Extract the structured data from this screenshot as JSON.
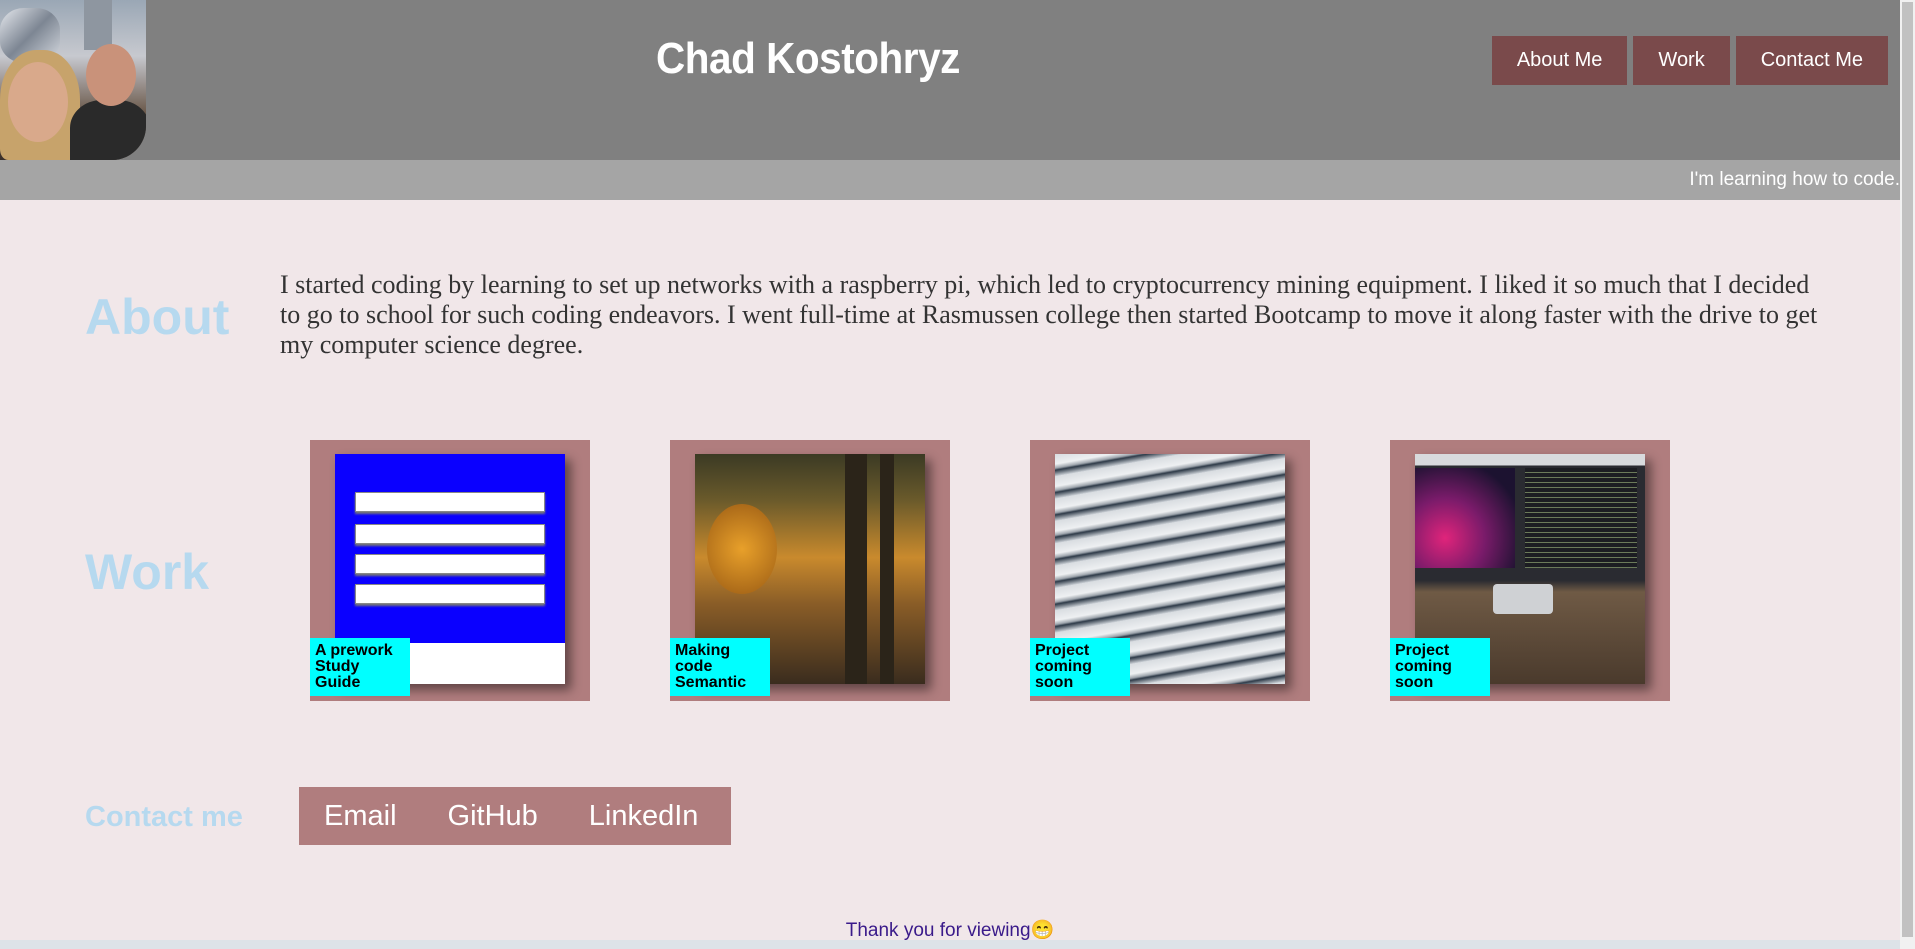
{
  "header": {
    "title": "Chad Kostohryz",
    "nav": [
      {
        "label": "About Me"
      },
      {
        "label": "Work"
      },
      {
        "label": "Contact Me"
      }
    ],
    "tagline": "I'm learning how to code."
  },
  "about": {
    "heading": "About",
    "text": "I started coding by learning to set up networks with a raspberry pi, which led to cryptocurrency mining equipment. I liked it so much that I decided to go to school for such coding endeavors. I went full-time at Rasmussen college then started Bootcamp to move it along faster with the drive to get my computer science degree."
  },
  "work": {
    "heading": "Work",
    "projects": [
      {
        "label": "A prework Study Guide"
      },
      {
        "label": "Making code Semantic"
      },
      {
        "label": "Project coming soon"
      },
      {
        "label": "Project coming soon"
      }
    ]
  },
  "contact": {
    "heading": "Contact me",
    "links": [
      {
        "label": "Email"
      },
      {
        "label": "GitHub"
      },
      {
        "label": "LinkedIn"
      }
    ]
  },
  "footer": {
    "text": "Thank you for viewing",
    "emoji": "😁"
  },
  "colors": {
    "header_bg": "#808080",
    "nav_bg": "#7a4a4b",
    "card_bg": "#b07d7e",
    "heading_color": "#b6d9ef",
    "label_bg": "#00ffff",
    "page_bg": "#f1e7e9"
  }
}
